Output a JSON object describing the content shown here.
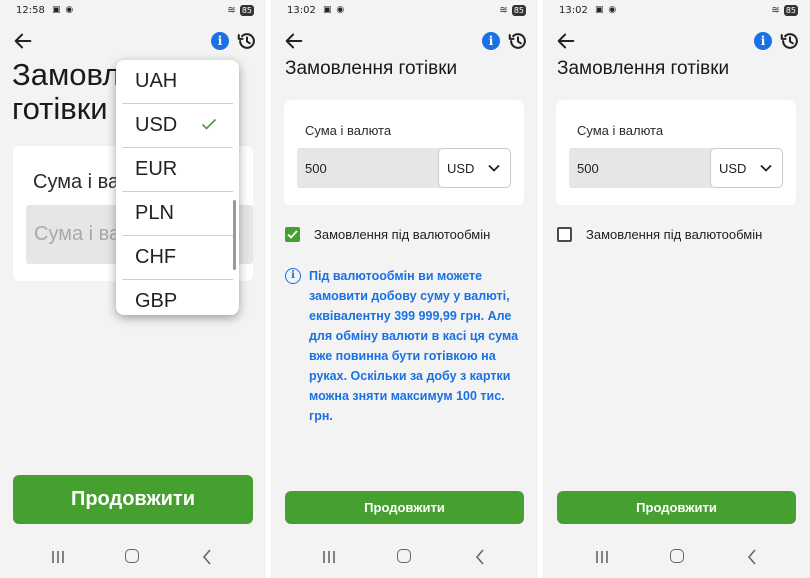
{
  "screens": [
    {
      "status_time": "12:58",
      "battery": "85",
      "title": "Замовлення готівки",
      "field_label": "Сума і валюта",
      "amount_placeholder": "Сума і валюта",
      "continue_label": "Продовжити",
      "currency_dropdown": {
        "options": [
          "UAH",
          "USD",
          "EUR",
          "PLN",
          "CHF",
          "GBP"
        ],
        "selected": "USD"
      }
    },
    {
      "status_time": "13:02",
      "battery": "85",
      "title": "Замовлення готівки",
      "field_label": "Сума і валюта",
      "amount_value": "500",
      "currency_value": "USD",
      "exchange_checkbox": {
        "label": "Замовлення під валютообмін",
        "checked": true
      },
      "info_text": "Під валютообмін ви можете замовити добову суму у валюті, еквівалентну 399 999,99 грн. Але для обміну валюти в касі ця сума вже повинна бути готівкою на руках. Оскільки за добу з картки можна зняти максимум 100 тис. грн.",
      "continue_label": "Продовжити"
    },
    {
      "status_time": "13:02",
      "battery": "85",
      "title": "Замовлення готівки",
      "field_label": "Сума і валюта",
      "amount_value": "500",
      "currency_value": "USD",
      "exchange_checkbox": {
        "label": "Замовлення під валютообмін",
        "checked": false
      },
      "continue_label": "Продовжити"
    }
  ],
  "icons": {
    "back": "arrow-left-icon",
    "info": "info-icon",
    "history": "history-icon",
    "check": "check-icon",
    "nav_recent": "recent-apps-icon",
    "nav_home": "home-icon",
    "nav_back": "back-chevron-icon"
  },
  "colors": {
    "accent_green": "#45a02f",
    "info_blue": "#1971e4",
    "background": "#f3f3f3"
  }
}
